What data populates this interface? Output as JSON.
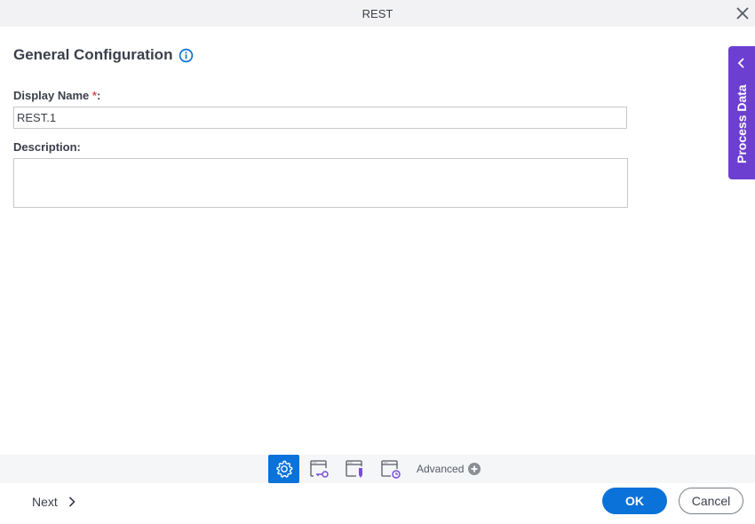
{
  "window": {
    "title": "REST",
    "close_icon": "close-icon"
  },
  "general": {
    "section_title": "General Configuration",
    "info_icon": "info-icon",
    "display_name_label": "Display Name",
    "required_marker": "*",
    "label_suffix": ":",
    "display_name_value": "REST.1",
    "description_label": "Description:",
    "description_value": ""
  },
  "process_data_tab": {
    "label": "Process Data",
    "icon": "chevron-left-icon"
  },
  "toolbar": {
    "items": [
      {
        "name": "general-configuration",
        "icon": "gear-icon",
        "active": true
      },
      {
        "name": "authentication",
        "icon": "window-key-icon",
        "active": false
      },
      {
        "name": "request",
        "icon": "window-pen-icon",
        "active": false
      },
      {
        "name": "response",
        "icon": "window-clock-icon",
        "active": false
      }
    ],
    "advanced_label": "Advanced",
    "advanced_icon": "plus-circle-icon"
  },
  "footer": {
    "next_label": "Next",
    "ok_label": "OK",
    "cancel_label": "Cancel"
  },
  "colors": {
    "accent": "#0a72d9",
    "process_data": "#6c3fd1",
    "required": "#d9534f"
  }
}
